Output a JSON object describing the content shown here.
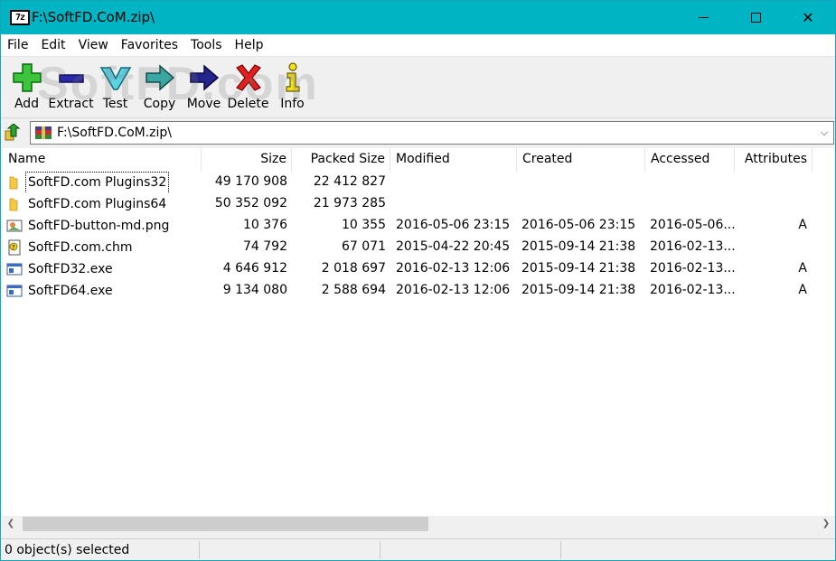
{
  "window": {
    "title": "F:\\SoftFD.CoM.zip\\",
    "app_icon_text": "7z",
    "controls": {
      "close": "✕"
    }
  },
  "menu": [
    "File",
    "Edit",
    "View",
    "Favorites",
    "Tools",
    "Help"
  ],
  "toolbar": {
    "watermark": "SoftFD.com",
    "buttons": [
      {
        "label": "Add",
        "icon": "add-icon"
      },
      {
        "label": "Extract",
        "icon": "extract-icon"
      },
      {
        "label": "Test",
        "icon": "test-icon"
      },
      {
        "label": "Copy",
        "icon": "copy-icon"
      },
      {
        "label": "Move",
        "icon": "move-icon"
      },
      {
        "label": "Delete",
        "icon": "delete-icon"
      },
      {
        "label": "Info",
        "icon": "info-icon"
      }
    ]
  },
  "address": {
    "path": "F:\\SoftFD.CoM.zip\\"
  },
  "columns": {
    "name": "Name",
    "size": "Size",
    "packed": "Packed Size",
    "modified": "Modified",
    "created": "Created",
    "accessed": "Accessed",
    "attributes": "Attributes"
  },
  "files": [
    {
      "name": "SoftFD.com Plugins32",
      "type": "folder",
      "size": "49 170 908",
      "packed": "22 412 827",
      "modified": "",
      "created": "",
      "accessed": "",
      "attr": ""
    },
    {
      "name": "SoftFD.com Plugins64",
      "type": "folder",
      "size": "50 352 092",
      "packed": "21 973 285",
      "modified": "",
      "created": "",
      "accessed": "",
      "attr": ""
    },
    {
      "name": "SoftFD-button-md.png",
      "type": "png",
      "size": "10 376",
      "packed": "10 355",
      "modified": "2016-05-06 23:15",
      "created": "2016-05-06 23:15",
      "accessed": "2016-05-06...",
      "attr": "A"
    },
    {
      "name": "SoftFD.com.chm",
      "type": "chm",
      "size": "74 792",
      "packed": "67 071",
      "modified": "2015-04-22 20:45",
      "created": "2015-09-14 21:38",
      "accessed": "2016-02-13...",
      "attr": ""
    },
    {
      "name": "SoftFD32.exe",
      "type": "exe",
      "size": "4 646 912",
      "packed": "2 018 697",
      "modified": "2016-02-13 12:06",
      "created": "2015-09-14 21:38",
      "accessed": "2016-02-13...",
      "attr": "A"
    },
    {
      "name": "SoftFD64.exe",
      "type": "exe",
      "size": "9 134 080",
      "packed": "2 588 694",
      "modified": "2016-02-13 12:06",
      "created": "2015-09-14 21:38",
      "accessed": "2016-02-13...",
      "attr": "A"
    }
  ],
  "status": {
    "selected": "0 object(s) selected"
  },
  "colors": {
    "titlebar": "#00b4c4",
    "folder": "#f5c842"
  }
}
